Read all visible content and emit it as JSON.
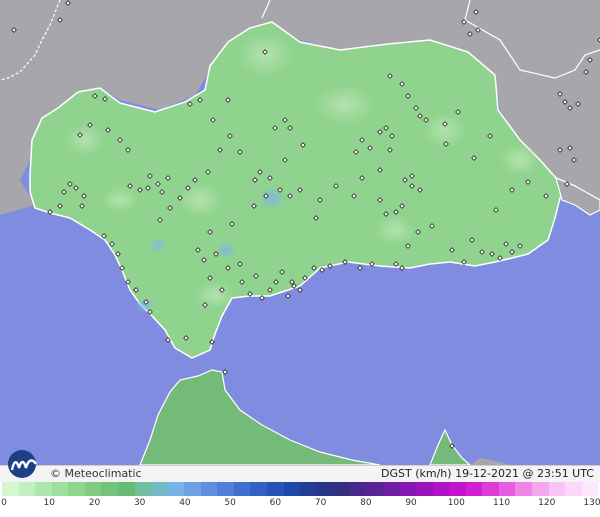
{
  "credit": "© Meteoclimatic",
  "title": "DGST (km/h)  19-12-2021 @ 23:51 UTC",
  "logo_icon": "meteoclimatic-logo-icon",
  "colors": {
    "sea": "#7f8ce0",
    "land_outside": "#a7a7ab",
    "region": "#8fd38e",
    "region_light": "#a4dd9f",
    "africa": "#74bb7a",
    "border": "#ffffff",
    "station": "#222222"
  },
  "scale": {
    "unit": "km/h",
    "ticks": [
      "0",
      "10",
      "20",
      "30",
      "40",
      "50",
      "60",
      "70",
      "80",
      "90",
      "100",
      "110",
      "120",
      "130"
    ],
    "colors": [
      "#d7f6d0",
      "#c3efbf",
      "#aee7ab",
      "#9ddf9b",
      "#8dd68c",
      "#80cd82",
      "#73c47a",
      "#67bb73",
      "#6fbfa0",
      "#74b9c6",
      "#79b2e6",
      "#6fa0e6",
      "#5f8fe0",
      "#4f7fd8",
      "#3f6fce",
      "#3260c4",
      "#2752b6",
      "#1f47a6",
      "#233c95",
      "#2a3488",
      "#34307e",
      "#482a8a",
      "#5a2496",
      "#6e1ea4",
      "#8418b2",
      "#9a14bc",
      "#b012c4",
      "#c414cb",
      "#d41cd2",
      "#de3ad8",
      "#e65ee0",
      "#ee86e8",
      "#f3a8ee",
      "#f7c4f3",
      "#fad8f7",
      "#fde8fb"
    ]
  },
  "stations": [
    [
      14,
      30
    ],
    [
      60,
      20
    ],
    [
      68,
      3
    ],
    [
      95,
      96
    ],
    [
      105,
      99
    ],
    [
      190,
      104
    ],
    [
      200,
      100
    ],
    [
      213,
      120
    ],
    [
      228,
      100
    ],
    [
      265,
      52
    ],
    [
      275,
      128
    ],
    [
      285,
      120
    ],
    [
      290,
      128
    ],
    [
      303,
      145
    ],
    [
      285,
      160
    ],
    [
      270,
      178
    ],
    [
      260,
      172
    ],
    [
      255,
      180
    ],
    [
      240,
      152
    ],
    [
      230,
      136
    ],
    [
      220,
      150
    ],
    [
      208,
      172
    ],
    [
      195,
      180
    ],
    [
      188,
      188
    ],
    [
      180,
      198
    ],
    [
      170,
      208
    ],
    [
      160,
      220
    ],
    [
      148,
      188
    ],
    [
      150,
      176
    ],
    [
      158,
      184
    ],
    [
      162,
      192
    ],
    [
      168,
      178
    ],
    [
      140,
      190
    ],
    [
      130,
      186
    ],
    [
      128,
      150
    ],
    [
      120,
      140
    ],
    [
      108,
      130
    ],
    [
      90,
      125
    ],
    [
      80,
      135
    ],
    [
      70,
      184
    ],
    [
      64,
      192
    ],
    [
      76,
      188
    ],
    [
      84,
      196
    ],
    [
      82,
      206
    ],
    [
      60,
      206
    ],
    [
      50,
      212
    ],
    [
      104,
      236
    ],
    [
      112,
      244
    ],
    [
      118,
      254
    ],
    [
      122,
      268
    ],
    [
      128,
      282
    ],
    [
      136,
      290
    ],
    [
      146,
      302
    ],
    [
      150,
      312
    ],
    [
      168,
      340
    ],
    [
      186,
      338
    ],
    [
      212,
      342
    ],
    [
      205,
      305
    ],
    [
      210,
      278
    ],
    [
      222,
      290
    ],
    [
      240,
      264
    ],
    [
      256,
      276
    ],
    [
      270,
      290
    ],
    [
      282,
      272
    ],
    [
      292,
      282
    ],
    [
      300,
      290
    ],
    [
      305,
      278
    ],
    [
      314,
      268
    ],
    [
      322,
      270
    ],
    [
      330,
      266
    ],
    [
      345,
      262
    ],
    [
      360,
      268
    ],
    [
      372,
      264
    ],
    [
      396,
      264
    ],
    [
      402,
      268
    ],
    [
      408,
      246
    ],
    [
      418,
      232
    ],
    [
      432,
      226
    ],
    [
      452,
      250
    ],
    [
      464,
      262
    ],
    [
      482,
      252
    ],
    [
      492,
      254
    ],
    [
      500,
      258
    ],
    [
      512,
      252
    ],
    [
      520,
      246
    ],
    [
      506,
      244
    ],
    [
      445,
      124
    ],
    [
      458,
      112
    ],
    [
      446,
      144
    ],
    [
      474,
      158
    ],
    [
      490,
      136
    ],
    [
      512,
      190
    ],
    [
      528,
      182
    ],
    [
      546,
      196
    ],
    [
      567,
      184
    ],
    [
      560,
      150
    ],
    [
      570,
      148
    ],
    [
      574,
      160
    ],
    [
      560,
      94
    ],
    [
      565,
      102
    ],
    [
      570,
      108
    ],
    [
      578,
      104
    ],
    [
      586,
      72
    ],
    [
      590,
      60
    ],
    [
      600,
      40
    ],
    [
      496,
      210
    ],
    [
      472,
      240
    ],
    [
      420,
      190
    ],
    [
      412,
      176
    ],
    [
      405,
      180
    ],
    [
      390,
      150
    ],
    [
      370,
      148
    ],
    [
      362,
      140
    ],
    [
      356,
      152
    ],
    [
      380,
      132
    ],
    [
      386,
      128
    ],
    [
      392,
      136
    ],
    [
      402,
      84
    ],
    [
      408,
      96
    ],
    [
      416,
      108
    ],
    [
      420,
      116
    ],
    [
      426,
      120
    ],
    [
      390,
      76
    ],
    [
      380,
      170
    ],
    [
      380,
      200
    ],
    [
      386,
      214
    ],
    [
      396,
      212
    ],
    [
      402,
      206
    ],
    [
      412,
      186
    ],
    [
      362,
      178
    ],
    [
      354,
      196
    ],
    [
      336,
      186
    ],
    [
      320,
      200
    ],
    [
      316,
      218
    ],
    [
      300,
      190
    ],
    [
      290,
      196
    ],
    [
      280,
      190
    ],
    [
      266,
      196
    ],
    [
      254,
      206
    ],
    [
      232,
      224
    ],
    [
      210,
      232
    ],
    [
      198,
      250
    ],
    [
      204,
      260
    ],
    [
      216,
      254
    ],
    [
      228,
      268
    ],
    [
      242,
      282
    ],
    [
      250,
      294
    ],
    [
      262,
      298
    ],
    [
      276,
      282
    ],
    [
      288,
      296
    ],
    [
      294,
      286
    ],
    [
      225,
      372
    ],
    [
      452,
      446
    ],
    [
      476,
      12
    ],
    [
      464,
      22
    ],
    [
      470,
      34
    ],
    [
      478,
      30
    ]
  ]
}
